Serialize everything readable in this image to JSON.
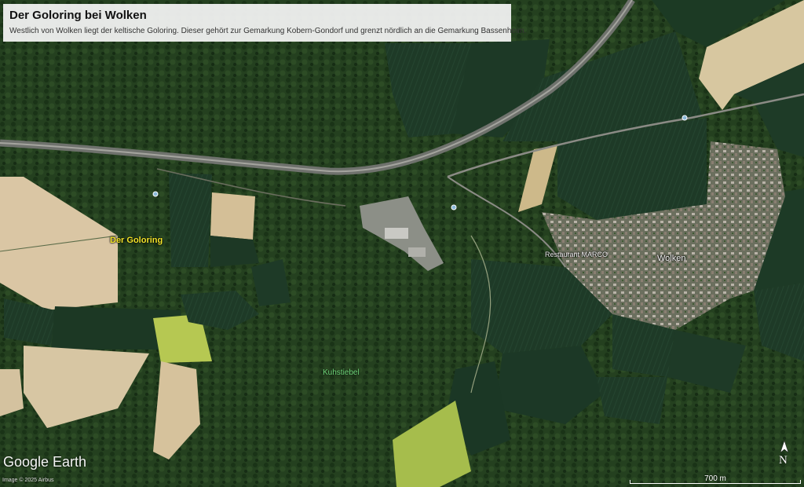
{
  "header": {
    "title": "Der Goloring bei Wolken",
    "description": "Westlich von Wolken liegt der keltische Goloring. Dieser gehört zur Gemarkung Kobern-Gondorf und grenzt nördlich an die Gemarkung Bassenheim."
  },
  "map_labels": {
    "goloring": "Der Goloring",
    "wolken": "Wolken",
    "restaurant": "Restaurant MARCO",
    "kuhstiebel": "Kuhstiebel"
  },
  "attribution": {
    "logo": "Google Earth",
    "copyright": "Image © 2025 Airbus"
  },
  "scale": {
    "label": "700 m"
  },
  "compass": {
    "label": "N",
    "icon": "north-arrow-icon"
  },
  "colors": {
    "forest": "#1f3a1c",
    "field_dark": "#1e3a26",
    "field_tan": "#d6c4a0",
    "field_lime": "#a3bb4a",
    "road": "#8c8c88",
    "label_highlight": "#f2e52a"
  }
}
